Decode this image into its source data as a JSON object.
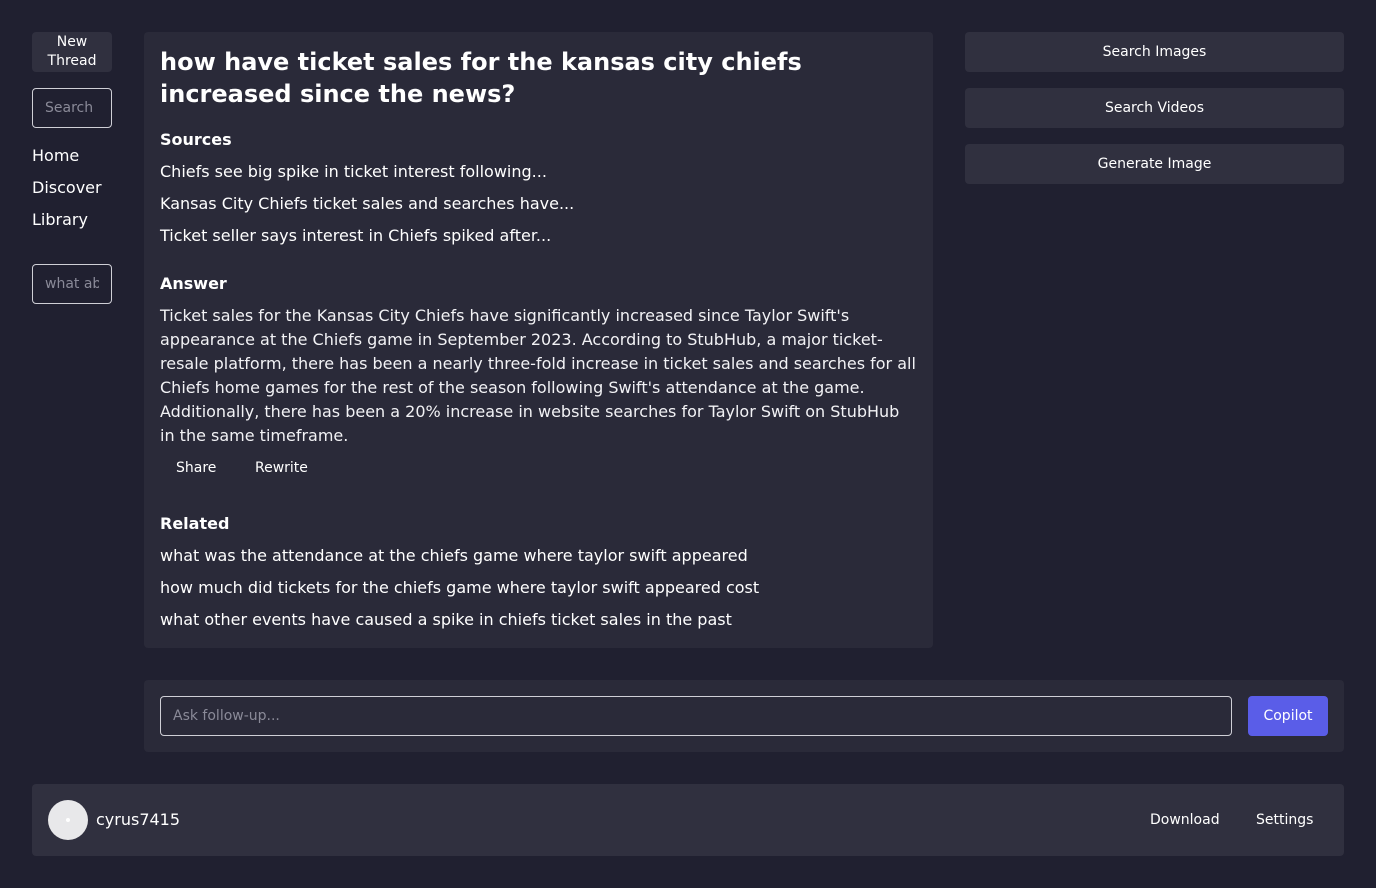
{
  "sidebar": {
    "new_thread_label": "New Thread",
    "search_placeholder": "Search",
    "nav": [
      "Home",
      "Discover",
      "Library"
    ],
    "recent_placeholder": "what ab"
  },
  "main": {
    "question": "how have ticket sales for the kansas city chiefs increased since the news?",
    "sources_heading": "Sources",
    "sources": [
      "Chiefs see big spike in ticket interest following...",
      "Kansas City Chiefs ticket sales and searches have...",
      "Ticket seller says interest in Chiefs spiked after..."
    ],
    "answer_heading": "Answer",
    "answer": "Ticket sales for the Kansas City Chiefs have significantly increased since Taylor Swift's appearance at the Chiefs game in September 2023. According to StubHub, a major ticket-resale platform, there has been a nearly three-fold increase in ticket sales and searches for all Chiefs home games for the rest of the season following Swift's attendance at the game. Additionally, there has been a 20% increase in website searches for Taylor Swift on StubHub in the same timeframe.",
    "share_label": "Share",
    "rewrite_label": "Rewrite",
    "related_heading": "Related",
    "related": [
      "what was the attendance at the chiefs game where taylor swift appeared",
      "how much did tickets for the chiefs game where taylor swift appeared cost",
      "what other events have caused a spike in chiefs ticket sales in the past"
    ]
  },
  "right_panel": {
    "search_images_label": "Search Images",
    "search_videos_label": "Search Videos",
    "generate_image_label": "Generate Image"
  },
  "followup": {
    "placeholder": "Ask follow-up...",
    "copilot_label": "Copilot"
  },
  "footer": {
    "username": "cyrus7415",
    "download_label": "Download",
    "settings_label": "Settings"
  },
  "colors": {
    "background": "#202030",
    "card": "#2a2a39",
    "button": "#30303f",
    "accent": "#5a5de8"
  }
}
